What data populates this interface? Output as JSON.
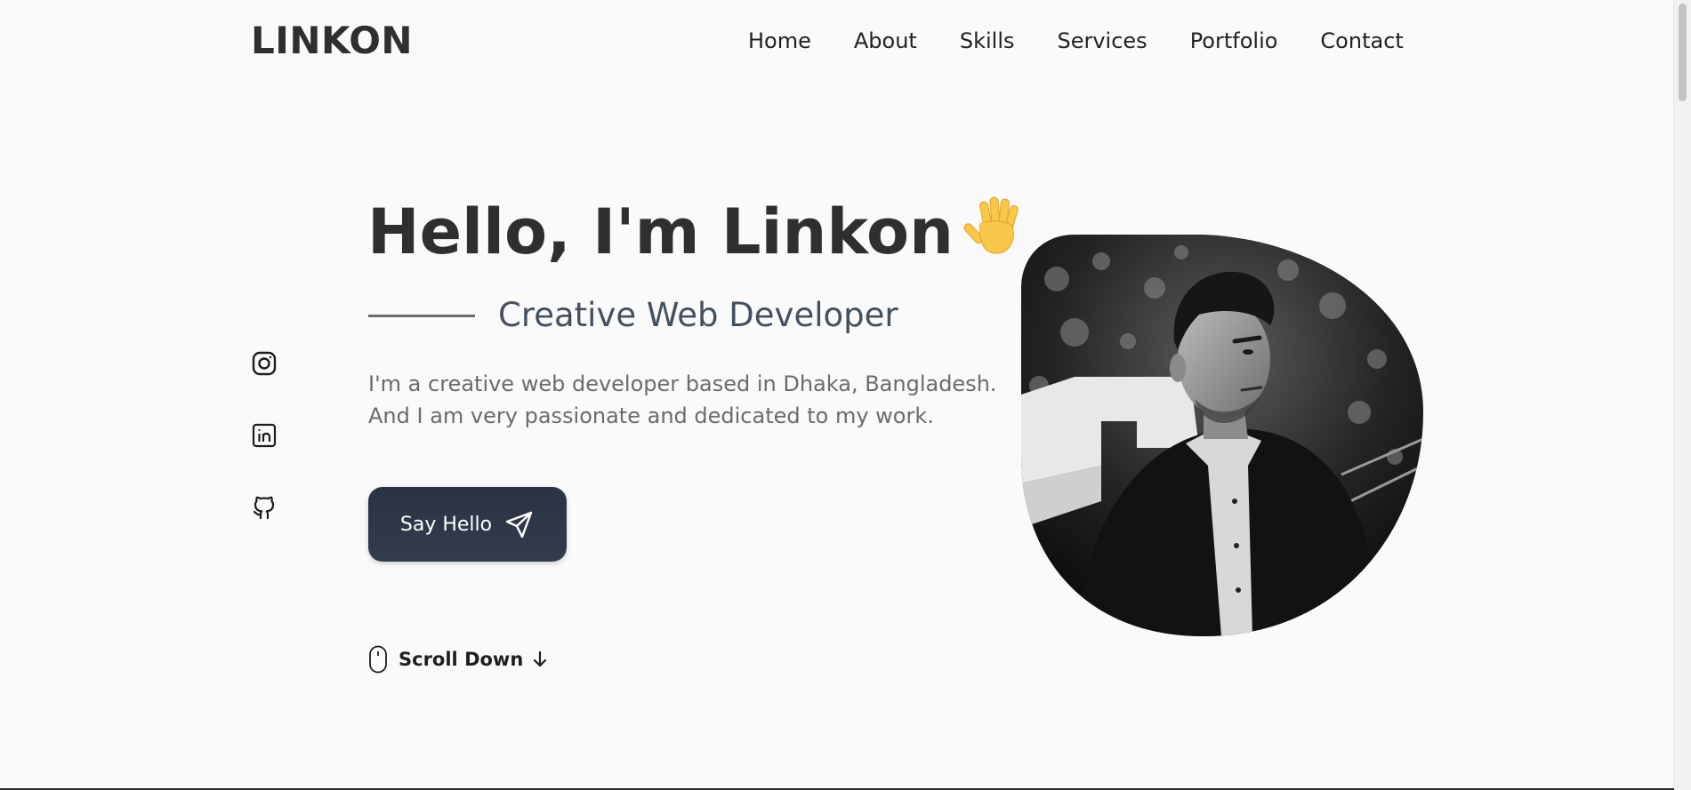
{
  "header": {
    "logo": "LINKON",
    "nav": [
      "Home",
      "About",
      "Skills",
      "Services",
      "Portfolio",
      "Contact"
    ]
  },
  "socials": [
    {
      "name": "Instagram",
      "icon": "instagram-icon"
    },
    {
      "name": "LinkedIn",
      "icon": "linkedin-icon"
    },
    {
      "name": "GitHub",
      "icon": "github-icon"
    }
  ],
  "hero": {
    "title": "Hello, I'm Linkon",
    "wave_icon": "waving-hand-icon",
    "subtitle": "Creative Web Developer",
    "description_lines": [
      "I'm a creative web developer based in Dhaka, Bangladesh.",
      "And I am very passionate and dedicated to my work."
    ],
    "cta_label": "Say Hello",
    "cta_icon": "send-plane-icon",
    "scroll_label": "Scroll Down",
    "scroll_icon": "mouse-icon",
    "portrait_icon": "profile-photo"
  },
  "colors": {
    "background": "#fafafa",
    "heading": "#2f2f2f",
    "subtitle": "#45505f",
    "button": "#2a3344",
    "button_text": "#ffffff",
    "wave": "#f7c84a"
  }
}
